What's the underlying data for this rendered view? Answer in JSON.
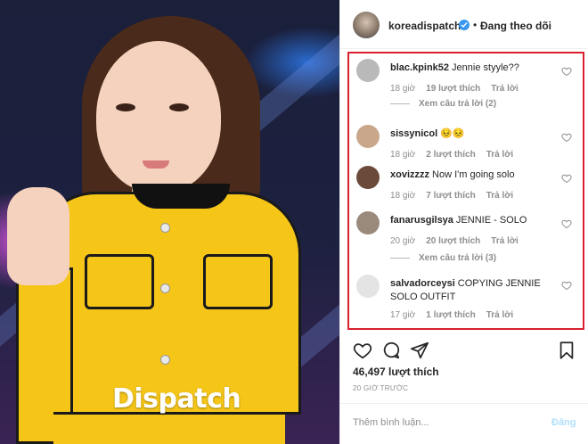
{
  "photo": {
    "watermark": "Dispatch"
  },
  "post": {
    "username": "koreadispatch",
    "dot": "•",
    "follow_label": "Đang theo dõi",
    "likes": "46,497 lượt thích",
    "time": "20 GIỜ TRƯỚC",
    "comment_placeholder": "Thêm bình luận...",
    "post_button": "Đăng"
  },
  "comments": [
    {
      "user": "blac.kpink52",
      "text": "Jennie styyle??",
      "time": "18 giờ",
      "likes": "19 lượt thích",
      "reply": "Trả lời",
      "avatar_color": "#b9b9b9"
    },
    {
      "user": "sissynicol",
      "text": "😣😣",
      "time": "18 giờ",
      "likes": "2 lượt thích",
      "reply": "Trả lời",
      "avatar_color": "#c9a78a"
    },
    {
      "user": "xovizzzz",
      "text": "Now I'm going solo",
      "time": "18 giờ",
      "likes": "7 lượt thích",
      "reply": "Trả lời",
      "avatar_color": "#6b4a3a"
    },
    {
      "user": "fanarusgilsya",
      "text": "JENNIE - SOLO",
      "time": "20 giờ",
      "likes": "20 lượt thích",
      "reply": "Trả lời",
      "avatar_color": "#9a8a7c"
    },
    {
      "user": "salvadorceysi",
      "text": "COPYING JENNIE SOLO OUTFIT",
      "time": "17 giờ",
      "likes": "1 lượt thích",
      "reply": "Trả lời",
      "avatar_color": "#e4e4e4"
    }
  ],
  "view_replies": [
    "Xem câu trả lời (2)",
    "Xem câu trả lời (3)"
  ],
  "icons": {
    "verified": "verified-badge-icon",
    "heart": "heart-icon",
    "comment": "comment-icon",
    "share": "share-icon",
    "bookmark": "bookmark-icon"
  },
  "colors": {
    "highlight_border": "#d9202c",
    "verified_blue": "#3897f0",
    "post_button_disabled": "#b2dffc",
    "jacket_yellow": "#f5c518"
  }
}
